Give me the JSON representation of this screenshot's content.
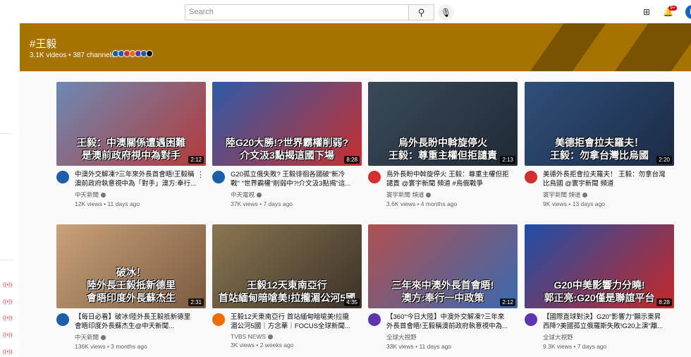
{
  "header": {
    "search_placeholder": "Search",
    "notification_count": "9+",
    "avatar_letter": "D"
  },
  "hashtag": {
    "title": "#王毅",
    "stats": "3.1K videos • 387 channels",
    "banner_color": "#a67200"
  },
  "videos": [
    {
      "title": "中澳外交解凍?三年來外長首會晤!王毅稱澳前政府執意視中為「對手」澳方:奉行...",
      "channel": "中天新聞",
      "verified": true,
      "stats": "12K views • 11 days ago",
      "duration": "2:12",
      "caption": [
        "王毅：中澳關係遭遇困難",
        "是澳前政府視中為對手"
      ],
      "thumb": [
        "#6d89b4",
        "#b33a3a"
      ],
      "avatar": "#1a5fa8"
    },
    {
      "title": "G20孤立俄失敗? 王毅徘徊各國破\"新冷戰\" \"世界霸權\"削弱中?!介文汲3點揭\"這...",
      "channel": "中天電視",
      "verified": true,
      "stats": "37K views • 7 days ago",
      "duration": "8:28",
      "caption": [
        "陸G20大勝!?世界霸權削弱?",
        "介文汲3點揭這國下場"
      ],
      "thumb": [
        "#2e5aa8",
        "#c53030"
      ],
      "avatar": "#1a5fa8"
    },
    {
      "title": "烏外長盼中斡旋停火 王毅：尊重主權但拒譴責 @寰宇新聞 頻道 #烏俄戰爭",
      "channel": "寰宇新聞 頻道",
      "verified": true,
      "stats": "3.6K views • 4 months ago",
      "duration": "2:13",
      "caption": [
        "烏外長盼中斡旋停火",
        "王毅：尊重主權但拒譴責"
      ],
      "thumb": [
        "#3a4a5a",
        "#1f2a35"
      ],
      "avatar": "#d32f2f"
    },
    {
      "title": "美德外長拒會拉夫羅夫！ 王毅：勿拿台灣比烏國 @寰宇新聞 頻道",
      "channel": "寰宇新聞 頻道",
      "verified": true,
      "stats": "9K views • 13 days ago",
      "duration": "2:20",
      "caption": [
        "美德拒會拉夫羅夫！",
        "王毅：勿拿台灣比烏國"
      ],
      "thumb": [
        "#2f4f7a",
        "#1b2b44"
      ],
      "avatar": "#d32f2f"
    },
    {
      "title": "【每日必看】破冰!陸外長王毅抵新德里 會晤印度外長蘇杰生@中天新聞...",
      "channel": "中天新聞",
      "verified": true,
      "stats": "136K views • 3 months ago",
      "duration": "2:31",
      "caption": [
        "破冰！",
        "陸外長王毅抵新德里",
        "會晤印度外長蘇杰生"
      ],
      "thumb": [
        "#c9a27a",
        "#7a5a40"
      ],
      "avatar": "#1a5fa8"
    },
    {
      "title": "王毅12天東南亞行 首站緬甸暗嗆美!拉攏湄公河5國｜方念華｜FOCUS全球新聞...",
      "channel": "TVBS NEWS",
      "verified": true,
      "stats": "3K views • 2 weeks ago",
      "duration": "4:35",
      "caption": [
        "王毅12天東南亞行",
        "首站緬甸暗嗆美!拉攏湄公河5國"
      ],
      "thumb": [
        "#8a7650",
        "#3b3228"
      ],
      "avatar": "#ef6c00"
    },
    {
      "title": "【360°今日大陸】中澳外交解凍?三年來外長首會晤!王毅稱澳前政府執意視中為...",
      "channel": "全球大視野",
      "verified": false,
      "stats": "33K views • 11 days ago",
      "duration": "2:12",
      "caption": [
        "三年來中澳外長首會晤!",
        "澳方:奉行一中政策"
      ],
      "thumb": [
        "#b05050",
        "#3a6ab0"
      ],
      "avatar": "#5e35b1"
    },
    {
      "title": "【國際直球對決】G20\"影響力\"顯示東昇西降?美國孤立俄羅斯失敗!G20上演\"離...",
      "channel": "全球大視野",
      "verified": false,
      "stats": "9.3K views • 7 days ago",
      "duration": "8:28",
      "caption": [
        "G20中美影響力分曉!",
        "郭正亮:G20僅是聯誼平台"
      ],
      "thumb": [
        "#1e4fa8",
        "#c62828"
      ],
      "avatar": "#5e35b1"
    }
  ],
  "colors": {
    "live_icon": "#ff3333",
    "banner_dark": "#7a5300"
  }
}
